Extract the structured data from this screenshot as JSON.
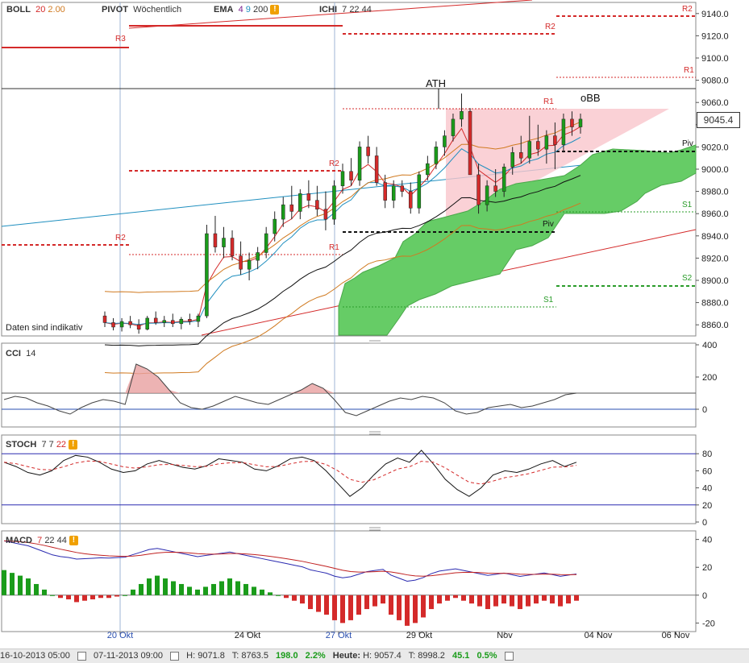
{
  "toolbar": {
    "boll": {
      "name": "BOLL",
      "p1": "20",
      "p2": "2.00"
    },
    "pivot": {
      "name": "PIVOT",
      "mode": "Wöchentlich"
    },
    "ema": {
      "name": "EMA",
      "p1": "4",
      "p2": "9",
      "p3": "200"
    },
    "ichi": {
      "name": "ICHI",
      "p1": "7",
      "p2": "22",
      "p3": "44"
    }
  },
  "price_panel": {
    "current_price": "9045.4",
    "disclaimer": "Daten sind indikativ",
    "ath_label": "ATH",
    "obb_label": "oBB",
    "pivot_labels": {
      "R3": "R3",
      "R2": "R2",
      "R1": "R1",
      "Piv": "Piv",
      "S1": "S1",
      "S2": "S2"
    }
  },
  "cci_panel": {
    "name": "CCI",
    "period": "14",
    "axis_ticks": [
      "400",
      "200",
      "0"
    ]
  },
  "stoch_panel": {
    "name": "STOCH",
    "p1": "7",
    "p2": "7",
    "p3": "22",
    "axis_ticks": [
      "80",
      "60",
      "40",
      "20",
      "0"
    ]
  },
  "macd_panel": {
    "name": "MACD",
    "p1": "7",
    "p2": "22",
    "p3": "44",
    "axis_ticks": [
      "40",
      "20",
      "0",
      "-20"
    ]
  },
  "x_axis": {
    "labels": [
      "20 Okt",
      "24 Okt",
      "27 Okt",
      "29 Okt",
      "Nov",
      "04 Nov",
      "06 Nov"
    ]
  },
  "statusbar": {
    "from": "16-10-2013 05:00",
    "to": "07-11-2013 09:00",
    "high": "H: 9071.8",
    "low": "T: 8763.5",
    "change": "198.0",
    "change_pct": "2.2%",
    "today_label": "Heute:",
    "today_high": "H: 9057.4",
    "today_low": "T: 8998.2",
    "today_change": "45.1",
    "today_pct": "0.5%"
  },
  "colors": {
    "up": "#1a9c1a",
    "down": "#d42a2a",
    "cloud": "#66cc66",
    "pivot": "#d42a2a",
    "support": "#2a9c2a",
    "purple": "#7a1f8f",
    "orange": "#d07a20",
    "teal": "#1f8fbf",
    "grid_axis": "#555"
  },
  "chart_data": [
    {
      "type": "candlestick",
      "y_ticks": [
        8860,
        8880,
        8900,
        8920,
        8940,
        8960,
        8980,
        9000,
        9020,
        9040,
        9060,
        9080,
        9100,
        9120,
        9140
      ],
      "ylim": [
        8850,
        9150
      ],
      "ohlc": [
        [
          8868,
          8872,
          8858,
          8862
        ],
        [
          8862,
          8866,
          8855,
          8858
        ],
        [
          8858,
          8866,
          8854,
          8863
        ],
        [
          8863,
          8868,
          8857,
          8860
        ],
        [
          8860,
          8865,
          8852,
          8856
        ],
        [
          8856,
          8868,
          8855,
          8866
        ],
        [
          8866,
          8872,
          8860,
          8862
        ],
        [
          8862,
          8868,
          8858,
          8864
        ],
        [
          8864,
          8870,
          8858,
          8861
        ],
        [
          8861,
          8867,
          8856,
          8865
        ],
        [
          8865,
          8870,
          8860,
          8863
        ],
        [
          8863,
          8870,
          8858,
          8868
        ],
        [
          8868,
          8950,
          8866,
          8942
        ],
        [
          8942,
          8958,
          8925,
          8930
        ],
        [
          8930,
          8948,
          8920,
          8938
        ],
        [
          8938,
          8945,
          8918,
          8922
        ],
        [
          8922,
          8935,
          8905,
          8910
        ],
        [
          8910,
          8925,
          8900,
          8918
        ],
        [
          8918,
          8930,
          8910,
          8925
        ],
        [
          8925,
          8948,
          8920,
          8942
        ],
        [
          8942,
          8962,
          8935,
          8955
        ],
        [
          8955,
          8975,
          8948,
          8968
        ],
        [
          8968,
          8985,
          8955,
          8962
        ],
        [
          8962,
          8982,
          8955,
          8978
        ],
        [
          8978,
          8990,
          8965,
          8972
        ],
        [
          8972,
          8985,
          8958,
          8964
        ],
        [
          8964,
          8980,
          8945,
          8955
        ],
        [
          8955,
          8990,
          8950,
          8985
        ],
        [
          8985,
          9005,
          8978,
          8998
        ],
        [
          8998,
          9010,
          8985,
          8990
        ],
        [
          8990,
          9025,
          8985,
          9020
        ],
        [
          9020,
          9030,
          9005,
          9012
        ],
        [
          9012,
          9020,
          8985,
          8988
        ],
        [
          8988,
          8995,
          8965,
          8972
        ],
        [
          8972,
          8990,
          8965,
          8985
        ],
        [
          8985,
          8990,
          8975,
          8980
        ],
        [
          8980,
          8988,
          8960,
          8965
        ],
        [
          8965,
          8998,
          8960,
          8995
        ],
        [
          8995,
          9012,
          8990,
          9005
        ],
        [
          9005,
          9025,
          9000,
          9020
        ],
        [
          9020,
          9035,
          9012,
          9030
        ],
        [
          9030,
          9050,
          9025,
          9045
        ],
        [
          9045,
          9068,
          9038,
          9052
        ],
        [
          9052,
          9055,
          9000,
          8995
        ],
        [
          8995,
          9005,
          8960,
          8968
        ],
        [
          8968,
          8990,
          8962,
          8985
        ],
        [
          8985,
          9000,
          8975,
          8980
        ],
        [
          8980,
          9005,
          8975,
          9002
        ],
        [
          9002,
          9020,
          8995,
          9015
        ],
        [
          9015,
          9030,
          9005,
          9010
        ],
        [
          9010,
          9048,
          9005,
          9025
        ],
        [
          9025,
          9040,
          9012,
          9018
        ],
        [
          9018,
          9035,
          9005,
          9030
        ],
        [
          9030,
          9042,
          9000,
          9022
        ],
        [
          9022,
          9050,
          9015,
          9045
        ],
        [
          9045,
          9052,
          9030,
          9038
        ],
        [
          9038,
          9050,
          9032,
          9045
        ]
      ]
    },
    {
      "type": "line",
      "name": "CCI",
      "ylim": [
        -100,
        400
      ],
      "y_ticks": [
        400,
        200,
        0
      ],
      "values": [
        60,
        80,
        70,
        40,
        20,
        -10,
        -30,
        10,
        40,
        60,
        50,
        30,
        280,
        250,
        200,
        120,
        40,
        10,
        0,
        20,
        50,
        80,
        60,
        40,
        30,
        60,
        90,
        120,
        160,
        130,
        60,
        -20,
        -40,
        -10,
        20,
        50,
        70,
        60,
        80,
        70,
        40,
        -10,
        -30,
        -20,
        10,
        20,
        30,
        10,
        20,
        40,
        60,
        90,
        100
      ]
    },
    {
      "type": "line",
      "name": "STOCH",
      "ylim": [
        0,
        100
      ],
      "y_ticks": [
        80,
        60,
        40,
        20,
        0
      ],
      "values": [
        70,
        65,
        58,
        55,
        60,
        72,
        78,
        76,
        70,
        62,
        58,
        60,
        68,
        72,
        68,
        64,
        62,
        66,
        74,
        72,
        70,
        62,
        60,
        66,
        74,
        76,
        72,
        60,
        45,
        30,
        40,
        55,
        68,
        75,
        70,
        84,
        68,
        50,
        38,
        30,
        40,
        55,
        60,
        58,
        62,
        68,
        72,
        65,
        70
      ]
    },
    {
      "type": "bar",
      "name": "MACD",
      "ylim": [
        -25,
        45
      ],
      "y_ticks": [
        40,
        20,
        0,
        -20
      ],
      "values": [
        18,
        16,
        14,
        12,
        8,
        4,
        0,
        -2,
        -3,
        -5,
        -4,
        -3,
        -2,
        -2,
        -1,
        0,
        4,
        8,
        12,
        14,
        12,
        10,
        8,
        6,
        4,
        6,
        8,
        10,
        12,
        10,
        8,
        6,
        4,
        2,
        0,
        -2,
        -4,
        -6,
        -10,
        -12,
        -14,
        -18,
        -20,
        -18,
        -14,
        -10,
        -8,
        -6,
        -14,
        -18,
        -22,
        -20,
        -16,
        -10,
        -6,
        -4,
        -2,
        -4,
        -6,
        -8,
        -10,
        -8,
        -6,
        -8,
        -10,
        -8,
        -6,
        -4,
        -6,
        -8,
        -6,
        -4
      ]
    }
  ]
}
